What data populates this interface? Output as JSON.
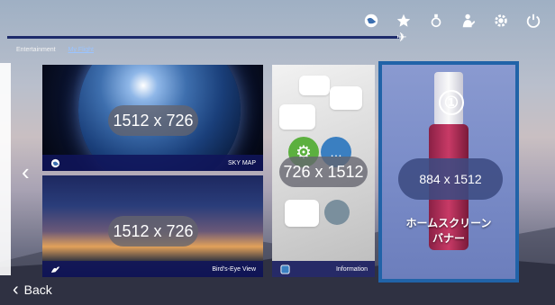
{
  "tabs": [
    {
      "label": "Entertainment",
      "active": false
    },
    {
      "label": "My Flight",
      "active": true
    }
  ],
  "top_icons": [
    "globe-icon",
    "star-icon",
    "medal-icon",
    "attendant-icon",
    "gear-icon",
    "power-icon"
  ],
  "tiles": {
    "skymap": {
      "size": "1512 x 726",
      "label": "SKY MAP"
    },
    "birdseye": {
      "size": "1512 x 726",
      "label": "Bird's-Eye View"
    },
    "info": {
      "size": "726 x 1512",
      "label": "Information"
    }
  },
  "banner": {
    "number": "①",
    "size": "884 x 1512",
    "title_line1": "ホームスクリーン",
    "title_line2": "バナー",
    "border_color": "#2163a8"
  },
  "back_label": "Back",
  "colors": {
    "footer": "#10145a",
    "progress": "#1d2b6b"
  }
}
